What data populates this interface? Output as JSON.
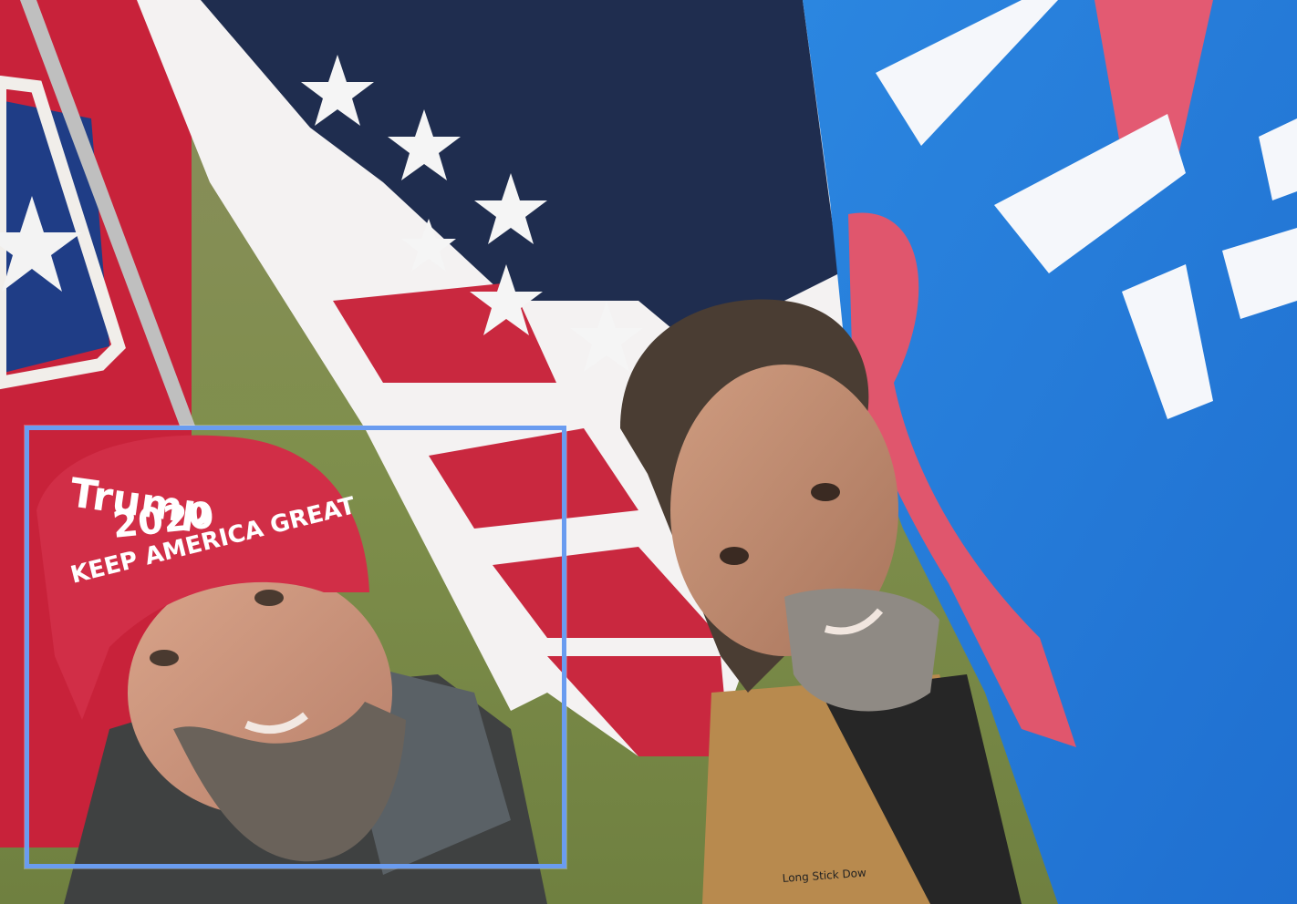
{
  "photo": {
    "subject": "selfie",
    "highlight_color": "#6a9cf0",
    "hat_text_line1": "Trump",
    "hat_text_line2": "2020",
    "hat_text_line3": "KEEP AMERICA GREAT",
    "jacket_text": "Long Stick Dow"
  }
}
